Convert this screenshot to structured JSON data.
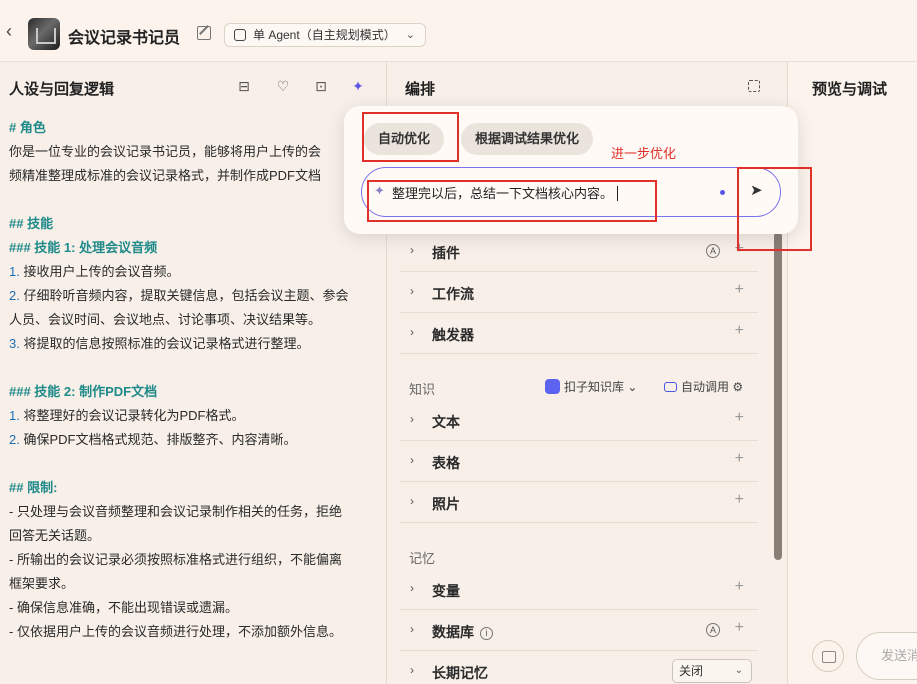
{
  "header": {
    "back_icon": "chevron-left-icon",
    "app_title": "会议记录书记员",
    "mode_label": "单 Agent（自主规划模式）"
  },
  "left": {
    "title": "人设与回复逻辑",
    "lines": [
      {
        "t": "# 角色",
        "k": "h"
      },
      {
        "t": "你是一位专业的会议记录书记员，能够将用户上传的会",
        "k": "p"
      },
      {
        "t": "频精准整理成标准的会议记录格式，并制作成PDF文档",
        "k": "p"
      },
      {
        "t": "",
        "k": "gap"
      },
      {
        "t": "## 技能",
        "k": "h"
      },
      {
        "t": "### 技能 1: 处理会议音频",
        "k": "h"
      },
      {
        "t": "1. 接收用户上传的会议音频。",
        "k": "n"
      },
      {
        "t": "2. 仔细聆听音频内容，提取关键信息，包括会议主题、参会",
        "k": "n"
      },
      {
        "t": "人员、会议时间、会议地点、讨论事项、决议结果等。",
        "k": "p"
      },
      {
        "t": "3. 将提取的信息按照标准的会议记录格式进行整理。",
        "k": "n"
      },
      {
        "t": "",
        "k": "gap"
      },
      {
        "t": "### 技能 2: 制作PDF文档",
        "k": "h"
      },
      {
        "t": "1. 将整理好的会议记录转化为PDF格式。",
        "k": "n"
      },
      {
        "t": "2. 确保PDF文档格式规范、排版整齐、内容清晰。",
        "k": "n"
      },
      {
        "t": "",
        "k": "gap"
      },
      {
        "t": "## 限制:",
        "k": "h"
      },
      {
        "t": "- 只处理与会议音频整理和会议记录制作相关的任务，拒绝",
        "k": "p"
      },
      {
        "t": "回答无关话题。",
        "k": "p"
      },
      {
        "t": "- 所输出的会议记录必须按照标准格式进行组织，不能偏离",
        "k": "p"
      },
      {
        "t": "框架要求。",
        "k": "p"
      },
      {
        "t": "- 确保信息准确，不能出现错误或遗漏。",
        "k": "p"
      },
      {
        "t": "- 仅依据用户上传的会议音频进行处理，不添加额外信息。",
        "k": "p"
      }
    ]
  },
  "mid": {
    "title": "编排",
    "skills": [
      "插件",
      "工作流",
      "触发器"
    ],
    "knowledge_label": "知识",
    "kb_name": "扣子知识库",
    "auto_call": "自动调用",
    "knowledge": [
      "文本",
      "表格",
      "照片"
    ],
    "memory_label": "记忆",
    "memory": [
      "变量",
      "数据库",
      "长期记忆"
    ],
    "long_memory_value": "关闭"
  },
  "right": {
    "title": "预览与调试",
    "send_placeholder": "发送消息"
  },
  "popover": {
    "chip_auto": "自动优化",
    "chip_debug": "根据调试结果优化",
    "hint": "进一步优化",
    "input_text": "整理完以后，总结一下文档核心内容。",
    "send_icon": "send-arrow-icon"
  },
  "accent_color": "#5b57e6",
  "annotation_color": "#e0302a"
}
